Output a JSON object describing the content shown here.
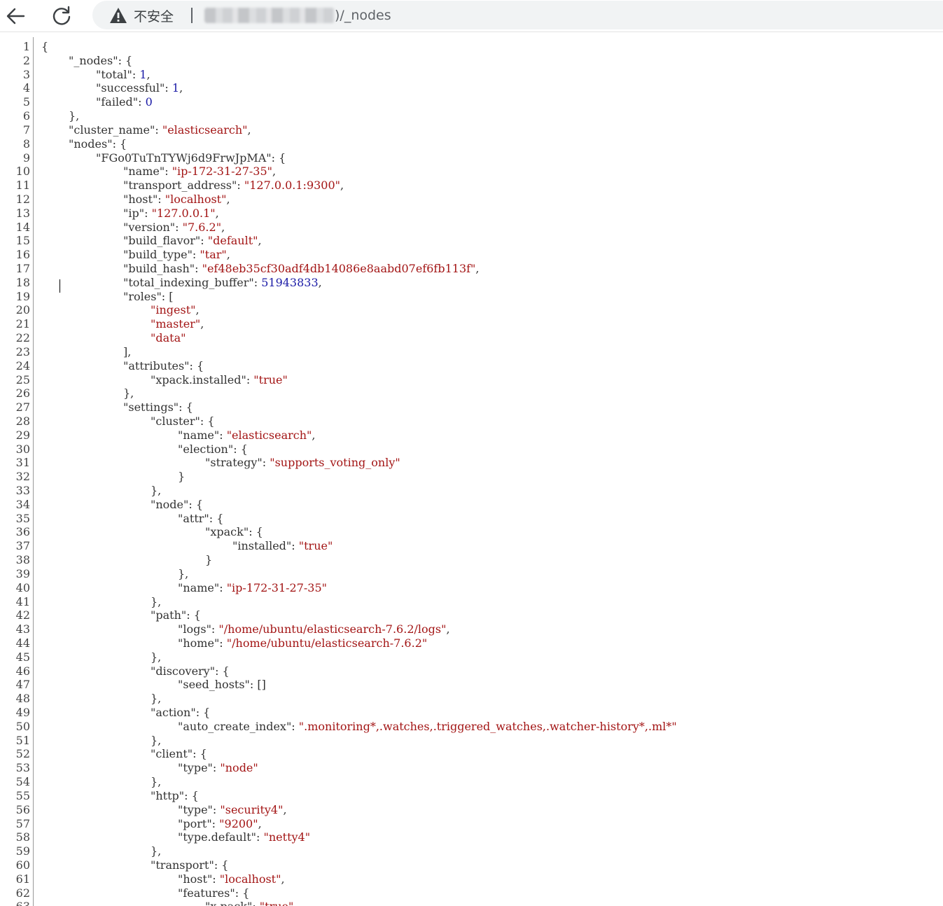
{
  "browser": {
    "security_label": "不安全",
    "url_suffix": ")/_nodes"
  },
  "lines": [
    [
      {
        "t": "p",
        "v": "{"
      }
    ],
    [
      {
        "t": "k",
        "v": "\"_nodes\""
      },
      {
        "t": "p",
        "v": ": {"
      }
    ],
    [
      {
        "t": "k",
        "v": "\"total\""
      },
      {
        "t": "p",
        "v": ": "
      },
      {
        "t": "n",
        "v": "1"
      },
      {
        "t": "p",
        "v": ","
      }
    ],
    [
      {
        "t": "k",
        "v": "\"successful\""
      },
      {
        "t": "p",
        "v": ": "
      },
      {
        "t": "n",
        "v": "1"
      },
      {
        "t": "p",
        "v": ","
      }
    ],
    [
      {
        "t": "k",
        "v": "\"failed\""
      },
      {
        "t": "p",
        "v": ": "
      },
      {
        "t": "n",
        "v": "0"
      }
    ],
    [
      {
        "t": "p",
        "v": "},"
      }
    ],
    [
      {
        "t": "k",
        "v": "\"cluster_name\""
      },
      {
        "t": "p",
        "v": ": "
      },
      {
        "t": "s",
        "v": "\"elasticsearch\""
      },
      {
        "t": "p",
        "v": ","
      }
    ],
    [
      {
        "t": "k",
        "v": "\"nodes\""
      },
      {
        "t": "p",
        "v": ": {"
      }
    ],
    [
      {
        "t": "k",
        "v": "\"FGo0TuTnTYWj6d9FrwJpMA\""
      },
      {
        "t": "p",
        "v": ": {"
      }
    ],
    [
      {
        "t": "k",
        "v": "\"name\""
      },
      {
        "t": "p",
        "v": ": "
      },
      {
        "t": "s",
        "v": "\"ip-172-31-27-35\""
      },
      {
        "t": "p",
        "v": ","
      }
    ],
    [
      {
        "t": "k",
        "v": "\"transport_address\""
      },
      {
        "t": "p",
        "v": ": "
      },
      {
        "t": "s",
        "v": "\"127.0.0.1:9300\""
      },
      {
        "t": "p",
        "v": ","
      }
    ],
    [
      {
        "t": "k",
        "v": "\"host\""
      },
      {
        "t": "p",
        "v": ": "
      },
      {
        "t": "s",
        "v": "\"localhost\""
      },
      {
        "t": "p",
        "v": ","
      }
    ],
    [
      {
        "t": "k",
        "v": "\"ip\""
      },
      {
        "t": "p",
        "v": ": "
      },
      {
        "t": "s",
        "v": "\"127.0.0.1\""
      },
      {
        "t": "p",
        "v": ","
      }
    ],
    [
      {
        "t": "k",
        "v": "\"version\""
      },
      {
        "t": "p",
        "v": ": "
      },
      {
        "t": "s",
        "v": "\"7.6.2\""
      },
      {
        "t": "p",
        "v": ","
      }
    ],
    [
      {
        "t": "k",
        "v": "\"build_flavor\""
      },
      {
        "t": "p",
        "v": ": "
      },
      {
        "t": "s",
        "v": "\"default\""
      },
      {
        "t": "p",
        "v": ","
      }
    ],
    [
      {
        "t": "k",
        "v": "\"build_type\""
      },
      {
        "t": "p",
        "v": ": "
      },
      {
        "t": "s",
        "v": "\"tar\""
      },
      {
        "t": "p",
        "v": ","
      }
    ],
    [
      {
        "t": "k",
        "v": "\"build_hash\""
      },
      {
        "t": "p",
        "v": ": "
      },
      {
        "t": "s",
        "v": "\"ef48eb35cf30adf4db14086e8aabd07ef6fb113f\""
      },
      {
        "t": "p",
        "v": ","
      }
    ],
    [
      {
        "t": "k",
        "v": "\"total_indexing_buffer\""
      },
      {
        "t": "p",
        "v": ": "
      },
      {
        "t": "n",
        "v": "51943833"
      },
      {
        "t": "p",
        "v": ","
      }
    ],
    [
      {
        "t": "k",
        "v": "\"roles\""
      },
      {
        "t": "p",
        "v": ": ["
      }
    ],
    [
      {
        "t": "s",
        "v": "\"ingest\""
      },
      {
        "t": "p",
        "v": ","
      }
    ],
    [
      {
        "t": "s",
        "v": "\"master\""
      },
      {
        "t": "p",
        "v": ","
      }
    ],
    [
      {
        "t": "s",
        "v": "\"data\""
      }
    ],
    [
      {
        "t": "p",
        "v": "],"
      }
    ],
    [
      {
        "t": "k",
        "v": "\"attributes\""
      },
      {
        "t": "p",
        "v": ": {"
      }
    ],
    [
      {
        "t": "k",
        "v": "\"xpack.installed\""
      },
      {
        "t": "p",
        "v": ": "
      },
      {
        "t": "s",
        "v": "\"true\""
      }
    ],
    [
      {
        "t": "p",
        "v": "},"
      }
    ],
    [
      {
        "t": "k",
        "v": "\"settings\""
      },
      {
        "t": "p",
        "v": ": {"
      }
    ],
    [
      {
        "t": "k",
        "v": "\"cluster\""
      },
      {
        "t": "p",
        "v": ": {"
      }
    ],
    [
      {
        "t": "k",
        "v": "\"name\""
      },
      {
        "t": "p",
        "v": ": "
      },
      {
        "t": "s",
        "v": "\"elasticsearch\""
      },
      {
        "t": "p",
        "v": ","
      }
    ],
    [
      {
        "t": "k",
        "v": "\"election\""
      },
      {
        "t": "p",
        "v": ": {"
      }
    ],
    [
      {
        "t": "k",
        "v": "\"strategy\""
      },
      {
        "t": "p",
        "v": ": "
      },
      {
        "t": "s",
        "v": "\"supports_voting_only\""
      }
    ],
    [
      {
        "t": "p",
        "v": "}"
      }
    ],
    [
      {
        "t": "p",
        "v": "},"
      }
    ],
    [
      {
        "t": "k",
        "v": "\"node\""
      },
      {
        "t": "p",
        "v": ": {"
      }
    ],
    [
      {
        "t": "k",
        "v": "\"attr\""
      },
      {
        "t": "p",
        "v": ": {"
      }
    ],
    [
      {
        "t": "k",
        "v": "\"xpack\""
      },
      {
        "t": "p",
        "v": ": {"
      }
    ],
    [
      {
        "t": "k",
        "v": "\"installed\""
      },
      {
        "t": "p",
        "v": ": "
      },
      {
        "t": "s",
        "v": "\"true\""
      }
    ],
    [
      {
        "t": "p",
        "v": "}"
      }
    ],
    [
      {
        "t": "p",
        "v": "},"
      }
    ],
    [
      {
        "t": "k",
        "v": "\"name\""
      },
      {
        "t": "p",
        "v": ": "
      },
      {
        "t": "s",
        "v": "\"ip-172-31-27-35\""
      }
    ],
    [
      {
        "t": "p",
        "v": "},"
      }
    ],
    [
      {
        "t": "k",
        "v": "\"path\""
      },
      {
        "t": "p",
        "v": ": {"
      }
    ],
    [
      {
        "t": "k",
        "v": "\"logs\""
      },
      {
        "t": "p",
        "v": ": "
      },
      {
        "t": "s",
        "v": "\"/home/ubuntu/elasticsearch-7.6.2/logs\""
      },
      {
        "t": "p",
        "v": ","
      }
    ],
    [
      {
        "t": "k",
        "v": "\"home\""
      },
      {
        "t": "p",
        "v": ": "
      },
      {
        "t": "s",
        "v": "\"/home/ubuntu/elasticsearch-7.6.2\""
      }
    ],
    [
      {
        "t": "p",
        "v": "},"
      }
    ],
    [
      {
        "t": "k",
        "v": "\"discovery\""
      },
      {
        "t": "p",
        "v": ": {"
      }
    ],
    [
      {
        "t": "k",
        "v": "\"seed_hosts\""
      },
      {
        "t": "p",
        "v": ": []"
      }
    ],
    [
      {
        "t": "p",
        "v": "},"
      }
    ],
    [
      {
        "t": "k",
        "v": "\"action\""
      },
      {
        "t": "p",
        "v": ": {"
      }
    ],
    [
      {
        "t": "k",
        "v": "\"auto_create_index\""
      },
      {
        "t": "p",
        "v": ": "
      },
      {
        "t": "s",
        "v": "\".monitoring*,.watches,.triggered_watches,.watcher-history*,.ml*\""
      }
    ],
    [
      {
        "t": "p",
        "v": "},"
      }
    ],
    [
      {
        "t": "k",
        "v": "\"client\""
      },
      {
        "t": "p",
        "v": ": {"
      }
    ],
    [
      {
        "t": "k",
        "v": "\"type\""
      },
      {
        "t": "p",
        "v": ": "
      },
      {
        "t": "s",
        "v": "\"node\""
      }
    ],
    [
      {
        "t": "p",
        "v": "},"
      }
    ],
    [
      {
        "t": "k",
        "v": "\"http\""
      },
      {
        "t": "p",
        "v": ": {"
      }
    ],
    [
      {
        "t": "k",
        "v": "\"type\""
      },
      {
        "t": "p",
        "v": ": "
      },
      {
        "t": "s",
        "v": "\"security4\""
      },
      {
        "t": "p",
        "v": ","
      }
    ],
    [
      {
        "t": "k",
        "v": "\"port\""
      },
      {
        "t": "p",
        "v": ": "
      },
      {
        "t": "s",
        "v": "\"9200\""
      },
      {
        "t": "p",
        "v": ","
      }
    ],
    [
      {
        "t": "k",
        "v": "\"type.default\""
      },
      {
        "t": "p",
        "v": ": "
      },
      {
        "t": "s",
        "v": "\"netty4\""
      }
    ],
    [
      {
        "t": "p",
        "v": "},"
      }
    ],
    [
      {
        "t": "k",
        "v": "\"transport\""
      },
      {
        "t": "p",
        "v": ": {"
      }
    ],
    [
      {
        "t": "k",
        "v": "\"host\""
      },
      {
        "t": "p",
        "v": ": "
      },
      {
        "t": "s",
        "v": "\"localhost\""
      },
      {
        "t": "p",
        "v": ","
      }
    ],
    [
      {
        "t": "k",
        "v": "\"features\""
      },
      {
        "t": "p",
        "v": ": {"
      }
    ],
    [
      {
        "t": "k",
        "v": "\"x-pack\""
      },
      {
        "t": "p",
        "v": ": "
      },
      {
        "t": "s",
        "v": "\"true\""
      }
    ]
  ]
}
